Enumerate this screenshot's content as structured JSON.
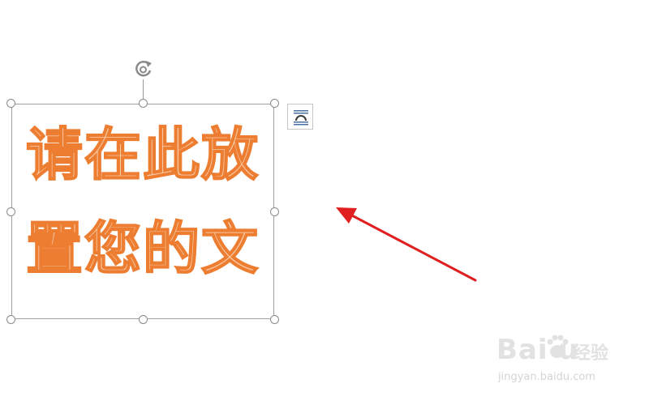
{
  "textbox": {
    "line1": "请在此放",
    "line2": "置您的文"
  },
  "layout_options": {
    "icon": "layout-options-icon"
  },
  "rotate": {
    "icon": "rotate-icon"
  },
  "annotation": {
    "icon": "red-arrow-icon",
    "color": "#e02020"
  },
  "wordart": {
    "fill": "#f9c9a4",
    "outline": "#ed7d31"
  },
  "watermark": {
    "brand": "Bai  u",
    "brand_cn": "经验",
    "url": "jingyan.baidu.com"
  }
}
